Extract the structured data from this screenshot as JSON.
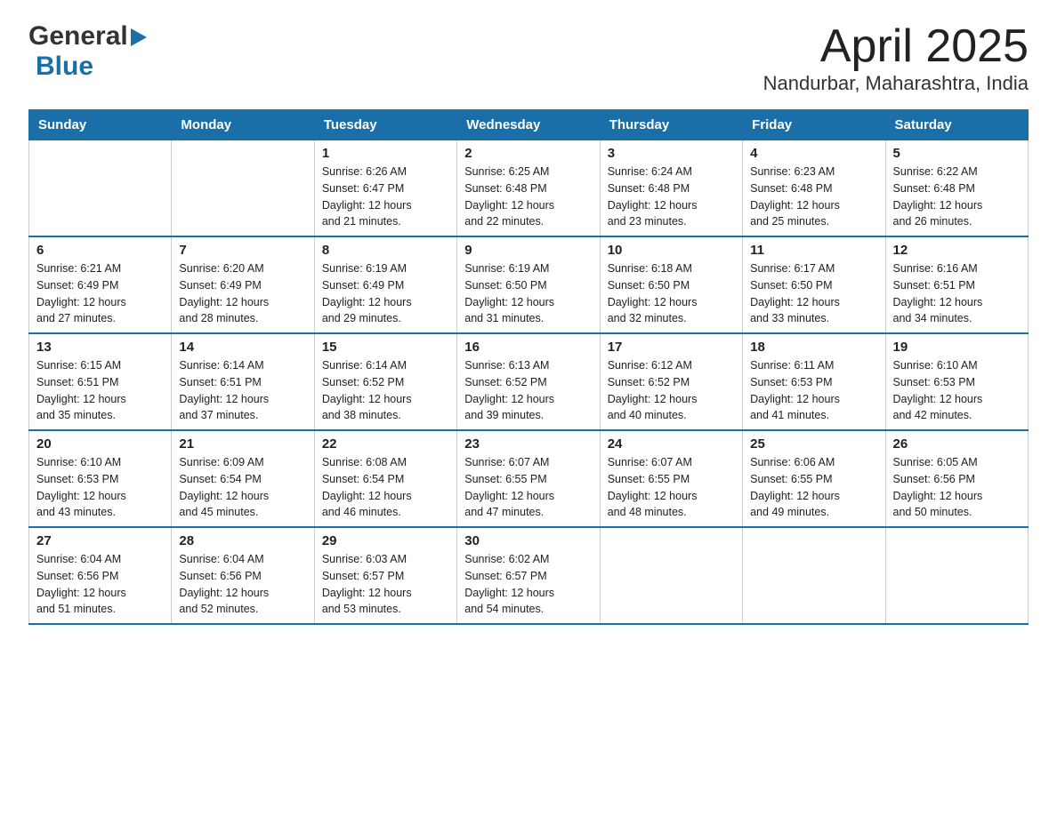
{
  "header": {
    "logo_general": "General",
    "logo_blue": "Blue",
    "month_title": "April 2025",
    "location": "Nandurbar, Maharashtra, India"
  },
  "days_of_week": [
    "Sunday",
    "Monday",
    "Tuesday",
    "Wednesday",
    "Thursday",
    "Friday",
    "Saturday"
  ],
  "weeks": [
    [
      {
        "day": "",
        "info": ""
      },
      {
        "day": "",
        "info": ""
      },
      {
        "day": "1",
        "info": "Sunrise: 6:26 AM\nSunset: 6:47 PM\nDaylight: 12 hours\nand 21 minutes."
      },
      {
        "day": "2",
        "info": "Sunrise: 6:25 AM\nSunset: 6:48 PM\nDaylight: 12 hours\nand 22 minutes."
      },
      {
        "day": "3",
        "info": "Sunrise: 6:24 AM\nSunset: 6:48 PM\nDaylight: 12 hours\nand 23 minutes."
      },
      {
        "day": "4",
        "info": "Sunrise: 6:23 AM\nSunset: 6:48 PM\nDaylight: 12 hours\nand 25 minutes."
      },
      {
        "day": "5",
        "info": "Sunrise: 6:22 AM\nSunset: 6:48 PM\nDaylight: 12 hours\nand 26 minutes."
      }
    ],
    [
      {
        "day": "6",
        "info": "Sunrise: 6:21 AM\nSunset: 6:49 PM\nDaylight: 12 hours\nand 27 minutes."
      },
      {
        "day": "7",
        "info": "Sunrise: 6:20 AM\nSunset: 6:49 PM\nDaylight: 12 hours\nand 28 minutes."
      },
      {
        "day": "8",
        "info": "Sunrise: 6:19 AM\nSunset: 6:49 PM\nDaylight: 12 hours\nand 29 minutes."
      },
      {
        "day": "9",
        "info": "Sunrise: 6:19 AM\nSunset: 6:50 PM\nDaylight: 12 hours\nand 31 minutes."
      },
      {
        "day": "10",
        "info": "Sunrise: 6:18 AM\nSunset: 6:50 PM\nDaylight: 12 hours\nand 32 minutes."
      },
      {
        "day": "11",
        "info": "Sunrise: 6:17 AM\nSunset: 6:50 PM\nDaylight: 12 hours\nand 33 minutes."
      },
      {
        "day": "12",
        "info": "Sunrise: 6:16 AM\nSunset: 6:51 PM\nDaylight: 12 hours\nand 34 minutes."
      }
    ],
    [
      {
        "day": "13",
        "info": "Sunrise: 6:15 AM\nSunset: 6:51 PM\nDaylight: 12 hours\nand 35 minutes."
      },
      {
        "day": "14",
        "info": "Sunrise: 6:14 AM\nSunset: 6:51 PM\nDaylight: 12 hours\nand 37 minutes."
      },
      {
        "day": "15",
        "info": "Sunrise: 6:14 AM\nSunset: 6:52 PM\nDaylight: 12 hours\nand 38 minutes."
      },
      {
        "day": "16",
        "info": "Sunrise: 6:13 AM\nSunset: 6:52 PM\nDaylight: 12 hours\nand 39 minutes."
      },
      {
        "day": "17",
        "info": "Sunrise: 6:12 AM\nSunset: 6:52 PM\nDaylight: 12 hours\nand 40 minutes."
      },
      {
        "day": "18",
        "info": "Sunrise: 6:11 AM\nSunset: 6:53 PM\nDaylight: 12 hours\nand 41 minutes."
      },
      {
        "day": "19",
        "info": "Sunrise: 6:10 AM\nSunset: 6:53 PM\nDaylight: 12 hours\nand 42 minutes."
      }
    ],
    [
      {
        "day": "20",
        "info": "Sunrise: 6:10 AM\nSunset: 6:53 PM\nDaylight: 12 hours\nand 43 minutes."
      },
      {
        "day": "21",
        "info": "Sunrise: 6:09 AM\nSunset: 6:54 PM\nDaylight: 12 hours\nand 45 minutes."
      },
      {
        "day": "22",
        "info": "Sunrise: 6:08 AM\nSunset: 6:54 PM\nDaylight: 12 hours\nand 46 minutes."
      },
      {
        "day": "23",
        "info": "Sunrise: 6:07 AM\nSunset: 6:55 PM\nDaylight: 12 hours\nand 47 minutes."
      },
      {
        "day": "24",
        "info": "Sunrise: 6:07 AM\nSunset: 6:55 PM\nDaylight: 12 hours\nand 48 minutes."
      },
      {
        "day": "25",
        "info": "Sunrise: 6:06 AM\nSunset: 6:55 PM\nDaylight: 12 hours\nand 49 minutes."
      },
      {
        "day": "26",
        "info": "Sunrise: 6:05 AM\nSunset: 6:56 PM\nDaylight: 12 hours\nand 50 minutes."
      }
    ],
    [
      {
        "day": "27",
        "info": "Sunrise: 6:04 AM\nSunset: 6:56 PM\nDaylight: 12 hours\nand 51 minutes."
      },
      {
        "day": "28",
        "info": "Sunrise: 6:04 AM\nSunset: 6:56 PM\nDaylight: 12 hours\nand 52 minutes."
      },
      {
        "day": "29",
        "info": "Sunrise: 6:03 AM\nSunset: 6:57 PM\nDaylight: 12 hours\nand 53 minutes."
      },
      {
        "day": "30",
        "info": "Sunrise: 6:02 AM\nSunset: 6:57 PM\nDaylight: 12 hours\nand 54 minutes."
      },
      {
        "day": "",
        "info": ""
      },
      {
        "day": "",
        "info": ""
      },
      {
        "day": "",
        "info": ""
      }
    ]
  ]
}
